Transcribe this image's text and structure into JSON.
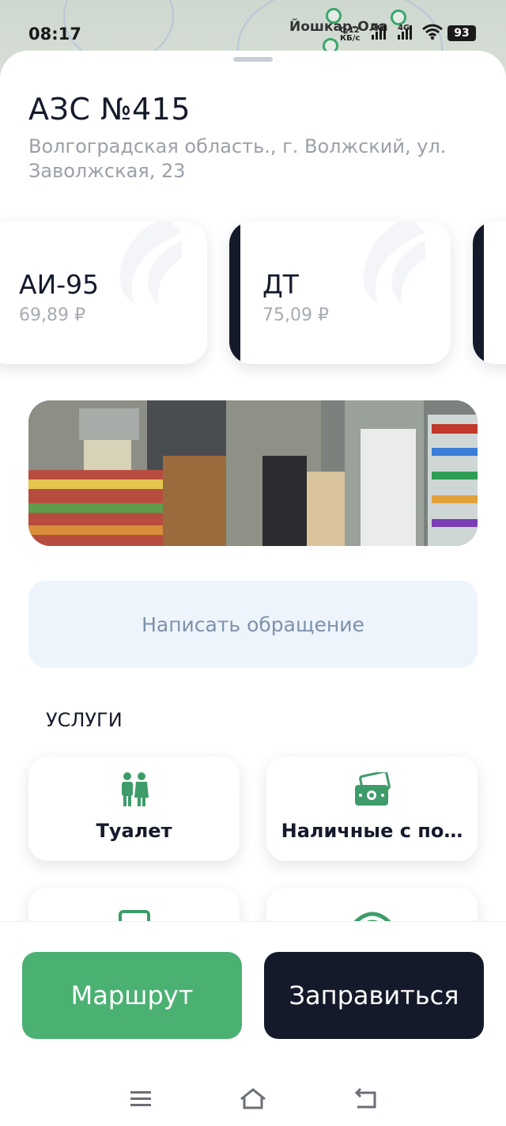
{
  "status_bar": {
    "time": "08:17",
    "map_city_label": "Йошкар-Ола",
    "speed_value": "0,12",
    "speed_unit": "КБ/с",
    "net_1": "2G",
    "net_2": "4G",
    "battery": "93"
  },
  "station": {
    "title": "АЗС №415",
    "address": "Волгоградская область., г. Волжский, ул. Заволжская, 23"
  },
  "fuels": [
    {
      "name": "АИ-95",
      "price": "69,89 ₽"
    },
    {
      "name": "ДТ",
      "price": "75,09 ₽"
    }
  ],
  "appeal_button": "Написать обращение",
  "services": {
    "heading": "УСЛУГИ",
    "items": [
      {
        "label": "Туалет",
        "icon": "toilet-icon"
      },
      {
        "label": "Наличные с по…",
        "icon": "cash-icon"
      },
      {
        "label": "",
        "icon": "card-terminal-icon"
      },
      {
        "label": "",
        "icon": "wifi-icon"
      }
    ]
  },
  "actions": {
    "route": "Маршрут",
    "refuel": "Заправиться"
  },
  "colors": {
    "accent_green": "#4bb173",
    "dark_navy": "#151a2b",
    "appeal_bg": "#eef4fb"
  }
}
